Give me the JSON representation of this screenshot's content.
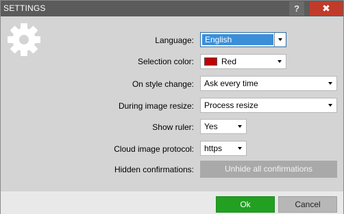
{
  "window": {
    "title": "SETTINGS",
    "help_label": "?",
    "close_label": "✖"
  },
  "icons": {
    "settings": "gear-icon"
  },
  "settings": {
    "language": {
      "label": "Language:",
      "value": "English"
    },
    "selection_color": {
      "label": "Selection color:",
      "value": "Red",
      "swatch": "#c30000"
    },
    "on_style_change": {
      "label": "On style change:",
      "value": "Ask every time"
    },
    "during_image_resize": {
      "label": "During image resize:",
      "value": "Process resize"
    },
    "show_ruler": {
      "label": "Show ruler:",
      "value": "Yes"
    },
    "cloud_image_protocol": {
      "label": "Cloud image protocol:",
      "value": "https"
    },
    "hidden_confirmations": {
      "label": "Hidden confirmations:",
      "button": "Unhide all confirmations"
    }
  },
  "footer": {
    "ok_label": "Ok",
    "cancel_label": "Cancel"
  },
  "colors": {
    "ok": "#22a022",
    "close": "#c13b2a",
    "selection": "#3b8fd9"
  }
}
